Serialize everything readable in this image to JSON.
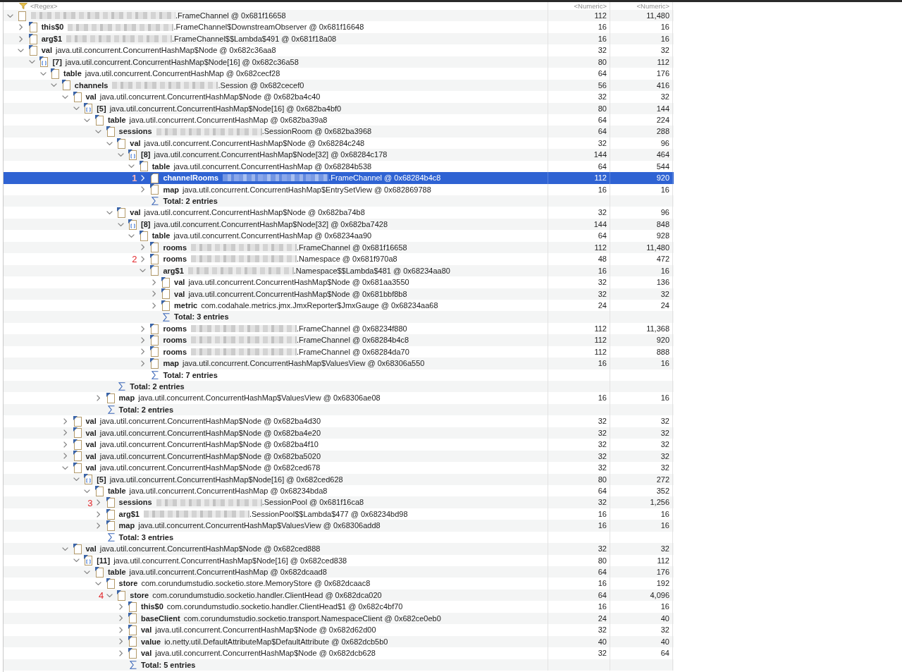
{
  "filter_row": [
    {
      "placeholder": "<Regex>"
    },
    {
      "placeholder": "<Numeric>"
    },
    {
      "placeholder": "<Numeric>"
    }
  ],
  "tree": [
    {
      "kind": "object",
      "redacted": true,
      "label": ".FrameChannel @ 0x681f16658",
      "column_2": "112",
      "column_3": "11,480",
      "expanded": true,
      "selected": false,
      "children": [
        {
          "kind": "field",
          "field": "this$0",
          "redacted": true,
          "label": ".FrameChannel$DownstreamObserver @ 0x681f16648",
          "column_2": "16",
          "column_3": "16",
          "expanded": false,
          "selected": false
        },
        {
          "kind": "field",
          "field": "arg$1",
          "redacted": true,
          "label": ".FrameChannel$$Lambda$491 @ 0x681f18a08",
          "column_2": "16",
          "column_3": "16",
          "expanded": false,
          "selected": false
        },
        {
          "kind": "field",
          "field": "val",
          "redacted": false,
          "label": "java.util.concurrent.ConcurrentHashMap$Node @ 0x682c36aa8",
          "column_2": "32",
          "column_3": "32",
          "expanded": true,
          "selected": false,
          "children": [
            {
              "kind": "array",
              "field": "[7]",
              "redacted": false,
              "label": "java.util.concurrent.ConcurrentHashMap$Node[16] @ 0x682c36a58",
              "column_2": "80",
              "column_3": "112",
              "expanded": true,
              "selected": false,
              "children": [
                {
                  "kind": "field",
                  "field": "table",
                  "redacted": false,
                  "label": "java.util.concurrent.ConcurrentHashMap @ 0x682cecf28",
                  "column_2": "64",
                  "column_3": "176",
                  "expanded": true,
                  "selected": false,
                  "children": [
                    {
                      "kind": "field",
                      "field": "channels",
                      "redacted": true,
                      "label": ".Session @ 0x682cecef0",
                      "column_2": "56",
                      "column_3": "416",
                      "expanded": true,
                      "selected": false,
                      "children": [
                        {
                          "kind": "field",
                          "field": "val",
                          "redacted": false,
                          "label": "java.util.concurrent.ConcurrentHashMap$Node @ 0x682ba4c40",
                          "column_2": "32",
                          "column_3": "32",
                          "expanded": true,
                          "selected": false,
                          "children": [
                            {
                              "kind": "array",
                              "field": "[5]",
                              "redacted": false,
                              "label": "java.util.concurrent.ConcurrentHashMap$Node[16] @ 0x682ba4bf0",
                              "column_2": "80",
                              "column_3": "144",
                              "expanded": true,
                              "selected": false,
                              "children": [
                                {
                                  "kind": "field",
                                  "field": "table",
                                  "redacted": false,
                                  "label": "java.util.concurrent.ConcurrentHashMap @ 0x682ba39a8",
                                  "column_2": "64",
                                  "column_3": "224",
                                  "expanded": true,
                                  "selected": false,
                                  "children": [
                                    {
                                      "kind": "field",
                                      "field": "sessions",
                                      "redacted": true,
                                      "label": ".SessionRoom @ 0x682ba3968",
                                      "column_2": "64",
                                      "column_3": "288",
                                      "expanded": true,
                                      "selected": false,
                                      "children": [
                                        {
                                          "kind": "field",
                                          "field": "val",
                                          "redacted": false,
                                          "label": "java.util.concurrent.ConcurrentHashMap$Node @ 0x68284c248",
                                          "column_2": "32",
                                          "column_3": "96",
                                          "expanded": true,
                                          "selected": false,
                                          "children": [
                                            {
                                              "kind": "array",
                                              "field": "[8]",
                                              "redacted": false,
                                              "label": "java.util.concurrent.ConcurrentHashMap$Node[32] @ 0x68284c178",
                                              "column_2": "144",
                                              "column_3": "464",
                                              "expanded": true,
                                              "selected": false,
                                              "children": [
                                                {
                                                  "kind": "field",
                                                  "field": "table",
                                                  "redacted": false,
                                                  "label": "java.util.concurrent.ConcurrentHashMap @ 0x68284b538",
                                                  "column_2": "64",
                                                  "column_3": "544",
                                                  "expanded": true,
                                                  "selected": false,
                                                  "children": [
                                                    {
                                                      "kind": "field",
                                                      "field": "channelRooms",
                                                      "redacted": true,
                                                      "label": ".FrameChannel @ 0x68284b4c8",
                                                      "column_2": "112",
                                                      "column_3": "920",
                                                      "expanded": false,
                                                      "selected": true,
                                                      "annotation": "1"
                                                    },
                                                    {
                                                      "kind": "field",
                                                      "field": "map",
                                                      "redacted": false,
                                                      "label": "java.util.concurrent.ConcurrentHashMap$EntrySetView @ 0x682869788",
                                                      "column_2": "16",
                                                      "column_3": "16",
                                                      "expanded": false,
                                                      "selected": false
                                                    },
                                                    {
                                                      "kind": "total",
                                                      "label": "Total: 2 entries",
                                                      "selected": false
                                                    }
                                                  ]
                                                }
                                              ]
                                            }
                                          ]
                                        },
                                        {
                                          "kind": "field",
                                          "field": "val",
                                          "redacted": false,
                                          "label": "java.util.concurrent.ConcurrentHashMap$Node @ 0x682ba74b8",
                                          "column_2": "32",
                                          "column_3": "96",
                                          "expanded": true,
                                          "selected": false,
                                          "children": [
                                            {
                                              "kind": "array",
                                              "field": "[8]",
                                              "redacted": false,
                                              "label": "java.util.concurrent.ConcurrentHashMap$Node[32] @ 0x682ba7428",
                                              "column_2": "144",
                                              "column_3": "848",
                                              "expanded": true,
                                              "selected": false,
                                              "children": [
                                                {
                                                  "kind": "field",
                                                  "field": "table",
                                                  "redacted": false,
                                                  "label": "java.util.concurrent.ConcurrentHashMap @ 0x68234aa90",
                                                  "column_2": "64",
                                                  "column_3": "928",
                                                  "expanded": true,
                                                  "selected": false,
                                                  "children": [
                                                    {
                                                      "kind": "field",
                                                      "field": "rooms",
                                                      "redacted": true,
                                                      "label": ".FrameChannel @ 0x681f16658",
                                                      "column_2": "112",
                                                      "column_3": "11,480",
                                                      "expanded": false,
                                                      "selected": false
                                                    },
                                                    {
                                                      "kind": "field",
                                                      "field": "rooms",
                                                      "redacted": true,
                                                      "label": ".Namespace @ 0x681f970a8",
                                                      "column_2": "48",
                                                      "column_3": "472",
                                                      "expanded": false,
                                                      "selected": false,
                                                      "annotation": "2"
                                                    },
                                                    {
                                                      "kind": "field",
                                                      "field": "arg$1",
                                                      "redacted": true,
                                                      "label": ".Namespace$$Lambda$481 @ 0x68234aa80",
                                                      "column_2": "16",
                                                      "column_3": "16",
                                                      "expanded": true,
                                                      "selected": false,
                                                      "children": [
                                                        {
                                                          "kind": "field",
                                                          "field": "val",
                                                          "redacted": false,
                                                          "label": "java.util.concurrent.ConcurrentHashMap$Node @ 0x681aa3550",
                                                          "column_2": "32",
                                                          "column_3": "136",
                                                          "expanded": false,
                                                          "selected": false
                                                        },
                                                        {
                                                          "kind": "field",
                                                          "field": "val",
                                                          "redacted": false,
                                                          "label": "java.util.concurrent.ConcurrentHashMap$Node @ 0x681bbf8b8",
                                                          "column_2": "32",
                                                          "column_3": "32",
                                                          "expanded": false,
                                                          "selected": false
                                                        },
                                                        {
                                                          "kind": "field",
                                                          "field": "metric",
                                                          "redacted": false,
                                                          "label": "com.codahale.metrics.jmx.JmxReporter$JmxGauge @ 0x68234aa68",
                                                          "column_2": "24",
                                                          "column_3": "24",
                                                          "expanded": false,
                                                          "selected": false
                                                        },
                                                        {
                                                          "kind": "total",
                                                          "label": "Total: 3 entries",
                                                          "selected": false
                                                        }
                                                      ]
                                                    },
                                                    {
                                                      "kind": "field",
                                                      "field": "rooms",
                                                      "redacted": true,
                                                      "label": ".FrameChannel @ 0x68234f880",
                                                      "column_2": "112",
                                                      "column_3": "11,368",
                                                      "expanded": false,
                                                      "selected": false
                                                    },
                                                    {
                                                      "kind": "field",
                                                      "field": "rooms",
                                                      "redacted": true,
                                                      "label": ".FrameChannel @ 0x68284b4c8",
                                                      "column_2": "112",
                                                      "column_3": "920",
                                                      "expanded": false,
                                                      "selected": false
                                                    },
                                                    {
                                                      "kind": "field",
                                                      "field": "rooms",
                                                      "redacted": true,
                                                      "label": ".FrameChannel @ 0x68284da70",
                                                      "column_2": "112",
                                                      "column_3": "888",
                                                      "expanded": false,
                                                      "selected": false
                                                    },
                                                    {
                                                      "kind": "field",
                                                      "field": "map",
                                                      "redacted": false,
                                                      "label": "java.util.concurrent.ConcurrentHashMap$ValuesView @ 0x68306a550",
                                                      "column_2": "16",
                                                      "column_3": "16",
                                                      "expanded": false,
                                                      "selected": false
                                                    },
                                                    {
                                                      "kind": "total",
                                                      "label": "Total: 7 entries",
                                                      "selected": false
                                                    }
                                                  ]
                                                }
                                              ]
                                            }
                                          ]
                                        },
                                        {
                                          "kind": "total",
                                          "label": "Total: 2 entries",
                                          "selected": false
                                        }
                                      ]
                                    },
                                    {
                                      "kind": "field",
                                      "field": "map",
                                      "redacted": false,
                                      "label": "java.util.concurrent.ConcurrentHashMap$ValuesView @ 0x68306ae08",
                                      "column_2": "16",
                                      "column_3": "16",
                                      "expanded": false,
                                      "selected": false
                                    },
                                    {
                                      "kind": "total",
                                      "label": "Total: 2 entries",
                                      "selected": false
                                    }
                                  ]
                                }
                              ]
                            }
                          ]
                        },
                        {
                          "kind": "field",
                          "field": "val",
                          "redacted": false,
                          "label": "java.util.concurrent.ConcurrentHashMap$Node @ 0x682ba4d30",
                          "column_2": "32",
                          "column_3": "32",
                          "expanded": false,
                          "selected": false
                        },
                        {
                          "kind": "field",
                          "field": "val",
                          "redacted": false,
                          "label": "java.util.concurrent.ConcurrentHashMap$Node @ 0x682ba4e20",
                          "column_2": "32",
                          "column_3": "32",
                          "expanded": false,
                          "selected": false
                        },
                        {
                          "kind": "field",
                          "field": "val",
                          "redacted": false,
                          "label": "java.util.concurrent.ConcurrentHashMap$Node @ 0x682ba4f10",
                          "column_2": "32",
                          "column_3": "32",
                          "expanded": false,
                          "selected": false
                        },
                        {
                          "kind": "field",
                          "field": "val",
                          "redacted": false,
                          "label": "java.util.concurrent.ConcurrentHashMap$Node @ 0x682ba5020",
                          "column_2": "32",
                          "column_3": "32",
                          "expanded": false,
                          "selected": false
                        },
                        {
                          "kind": "field",
                          "field": "val",
                          "redacted": false,
                          "label": "java.util.concurrent.ConcurrentHashMap$Node @ 0x682ced678",
                          "column_2": "32",
                          "column_3": "32",
                          "expanded": true,
                          "selected": false,
                          "children": [
                            {
                              "kind": "array",
                              "field": "[5]",
                              "redacted": false,
                              "label": "java.util.concurrent.ConcurrentHashMap$Node[16] @ 0x682ced628",
                              "column_2": "80",
                              "column_3": "272",
                              "expanded": true,
                              "selected": false,
                              "children": [
                                {
                                  "kind": "field",
                                  "field": "table",
                                  "redacted": false,
                                  "label": "java.util.concurrent.ConcurrentHashMap @ 0x68234bda8",
                                  "column_2": "64",
                                  "column_3": "352",
                                  "expanded": true,
                                  "selected": false,
                                  "children": [
                                    {
                                      "kind": "field",
                                      "field": "sessions",
                                      "redacted": true,
                                      "label": ".SessionPool @ 0x681f16ca8",
                                      "column_2": "32",
                                      "column_3": "1,256",
                                      "expanded": false,
                                      "selected": false,
                                      "annotation": "3"
                                    },
                                    {
                                      "kind": "field",
                                      "field": "arg$1",
                                      "redacted": true,
                                      "label": ".SessionPool$$Lambda$477 @ 0x68234bd98",
                                      "column_2": "16",
                                      "column_3": "16",
                                      "expanded": false,
                                      "selected": false
                                    },
                                    {
                                      "kind": "field",
                                      "field": "map",
                                      "redacted": false,
                                      "label": "java.util.concurrent.ConcurrentHashMap$ValuesView @ 0x68306add8",
                                      "column_2": "16",
                                      "column_3": "16",
                                      "expanded": false,
                                      "selected": false
                                    },
                                    {
                                      "kind": "total",
                                      "label": "Total: 3 entries",
                                      "selected": false
                                    }
                                  ]
                                }
                              ]
                            }
                          ]
                        },
                        {
                          "kind": "field",
                          "field": "val",
                          "redacted": false,
                          "label": "java.util.concurrent.ConcurrentHashMap$Node @ 0x682ced888",
                          "column_2": "32",
                          "column_3": "32",
                          "expanded": true,
                          "selected": false,
                          "children": [
                            {
                              "kind": "array",
                              "field": "[11]",
                              "redacted": false,
                              "label": "java.util.concurrent.ConcurrentHashMap$Node[16] @ 0x682ced838",
                              "column_2": "80",
                              "column_3": "112",
                              "expanded": true,
                              "selected": false,
                              "children": [
                                {
                                  "kind": "field",
                                  "field": "table",
                                  "redacted": false,
                                  "label": "java.util.concurrent.ConcurrentHashMap @ 0x682dcaad8",
                                  "column_2": "64",
                                  "column_3": "176",
                                  "expanded": true,
                                  "selected": false,
                                  "children": [
                                    {
                                      "kind": "field",
                                      "field": "store",
                                      "redacted": false,
                                      "label": "com.corundumstudio.socketio.store.MemoryStore @ 0x682dcaac8",
                                      "column_2": "16",
                                      "column_3": "192",
                                      "expanded": true,
                                      "selected": false,
                                      "children": [
                                        {
                                          "kind": "field",
                                          "field": "store",
                                          "redacted": false,
                                          "label": "com.corundumstudio.socketio.handler.ClientHead @ 0x682dca020",
                                          "column_2": "64",
                                          "column_3": "4,096",
                                          "expanded": true,
                                          "selected": false,
                                          "annotation": "4",
                                          "children": [
                                            {
                                              "kind": "field",
                                              "field": "this$0",
                                              "redacted": false,
                                              "label": "com.corundumstudio.socketio.handler.ClientHead$1 @ 0x682c4bf70",
                                              "column_2": "16",
                                              "column_3": "16",
                                              "expanded": false,
                                              "selected": false
                                            },
                                            {
                                              "kind": "field",
                                              "field": "baseClient",
                                              "redacted": false,
                                              "label": "com.corundumstudio.socketio.transport.NamespaceClient @ 0x682ce0eb0",
                                              "column_2": "24",
                                              "column_3": "40",
                                              "expanded": false,
                                              "selected": false
                                            },
                                            {
                                              "kind": "field",
                                              "field": "val",
                                              "redacted": false,
                                              "label": "java.util.concurrent.ConcurrentHashMap$Node @ 0x682d62d00",
                                              "column_2": "32",
                                              "column_3": "32",
                                              "expanded": false,
                                              "selected": false
                                            },
                                            {
                                              "kind": "field",
                                              "field": "value",
                                              "redacted": false,
                                              "label": "io.netty.util.DefaultAttributeMap$DefaultAttribute @ 0x682dcb5b0",
                                              "column_2": "40",
                                              "column_3": "40",
                                              "expanded": false,
                                              "selected": false
                                            },
                                            {
                                              "kind": "field",
                                              "field": "val",
                                              "redacted": false,
                                              "label": "java.util.concurrent.ConcurrentHashMap$Node @ 0x682dcb628",
                                              "column_2": "32",
                                              "column_3": "64",
                                              "expanded": false,
                                              "selected": false
                                            },
                                            {
                                              "kind": "total",
                                              "label": "Total: 5 entries",
                                              "selected": false
                                            }
                                          ]
                                        }
                                      ]
                                    }
                                  ]
                                }
                              ]
                            }
                          ]
                        }
                      ]
                    }
                  ]
                }
              ]
            }
          ]
        }
      ]
    }
  ]
}
